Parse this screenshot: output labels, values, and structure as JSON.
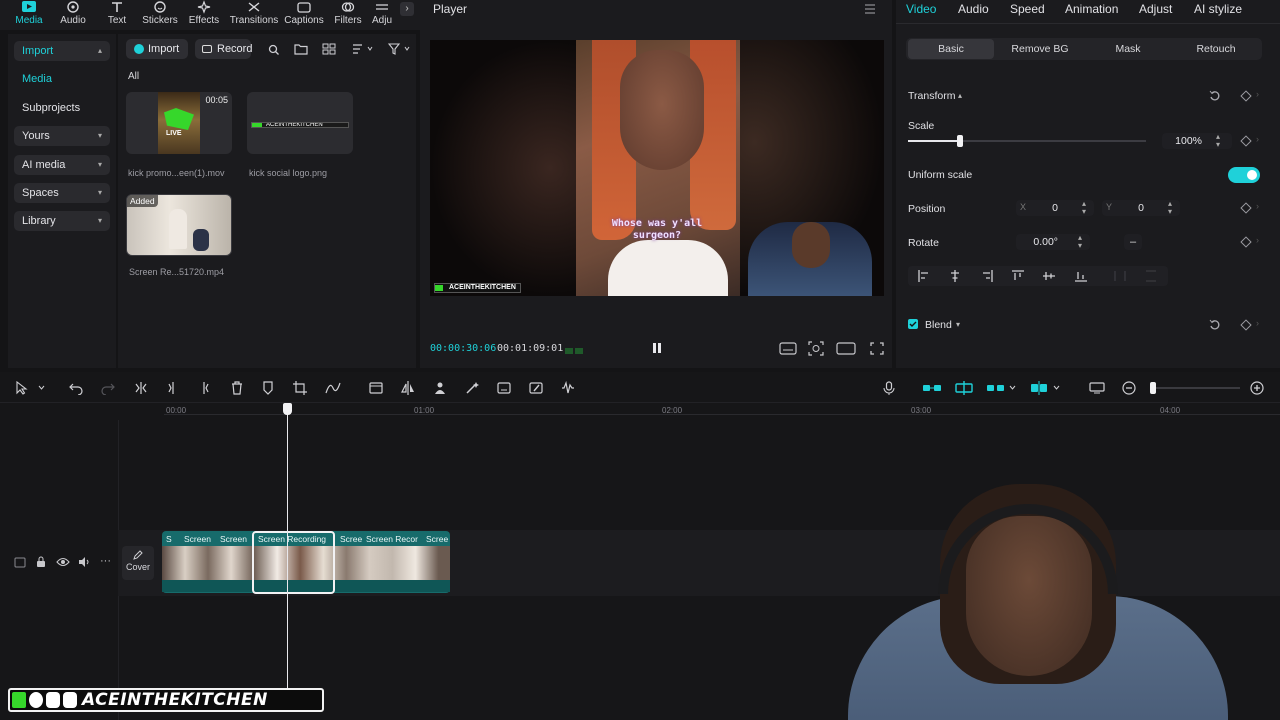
{
  "top_tools": [
    {
      "label": "Media",
      "icon": "media-icon"
    },
    {
      "label": "Audio",
      "icon": "audio-icon"
    },
    {
      "label": "Text",
      "icon": "text-icon"
    },
    {
      "label": "Stickers",
      "icon": "sticker-icon"
    },
    {
      "label": "Effects",
      "icon": "effects-icon"
    },
    {
      "label": "Transitions",
      "icon": "transitions-icon"
    },
    {
      "label": "Captions",
      "icon": "captions-icon"
    },
    {
      "label": "Filters",
      "icon": "filters-icon"
    },
    {
      "label": "Adju",
      "icon": "adjust-icon"
    }
  ],
  "left_nav": {
    "import": "Import",
    "media": "Media",
    "subprojects": "Subprojects",
    "yours": "Yours",
    "ai_media": "AI media",
    "spaces": "Spaces",
    "library": "Library"
  },
  "media_pane": {
    "import_btn": "Import",
    "record_btn": "Record",
    "filter_all": "All",
    "items": [
      {
        "name": "kick promo...een(1).mov",
        "duration": "00:05",
        "badge": ""
      },
      {
        "name": "kick social logo.png",
        "duration": "",
        "badge": ""
      },
      {
        "name": "Screen Re...51720.mp4",
        "duration": "",
        "badge": "Added"
      }
    ],
    "logo_thumb_text": "ACEINTHEKITCHEN",
    "live_text": "LIVE"
  },
  "player": {
    "title": "Player",
    "current_time": "00:00:30:06",
    "total_time": "00:01:09:01",
    "caption": "Whose was y'all surgeon?",
    "watermark": "ACEINTHEKITCHEN",
    "state": "playing"
  },
  "props": {
    "tabs": [
      "Video",
      "Audio",
      "Speed",
      "Animation",
      "Adjust",
      "AI stylize"
    ],
    "subtabs": [
      "Basic",
      "Remove BG",
      "Mask",
      "Retouch"
    ],
    "transform_label": "Transform",
    "scale_label": "Scale",
    "scale_value": "100%",
    "scale_level": 0.22,
    "uniform_label": "Uniform scale",
    "uniform_on": true,
    "position_label": "Position",
    "pos_x_label": "X",
    "pos_x": "0",
    "pos_y_label": "Y",
    "pos_y": "0",
    "rotate_label": "Rotate",
    "rotate_value": "0.00°",
    "rotate_minus": "–",
    "blend_label": "Blend",
    "accent": "#1fd1d9"
  },
  "timeline": {
    "ruler": [
      "00:00",
      "01:00",
      "02:00",
      "03:00",
      "04:00"
    ],
    "cover_label": "Cover",
    "clips": [
      "S",
      "Screen",
      "Screen",
      "Screen Recording",
      "Scree",
      "Screen Recor",
      "Scree"
    ]
  },
  "watermark": {
    "handle": "ACEINTHEKITCHEN",
    "icons": [
      "kick-icon",
      "facebook-icon",
      "instagram-icon",
      "tiktok-icon"
    ]
  }
}
